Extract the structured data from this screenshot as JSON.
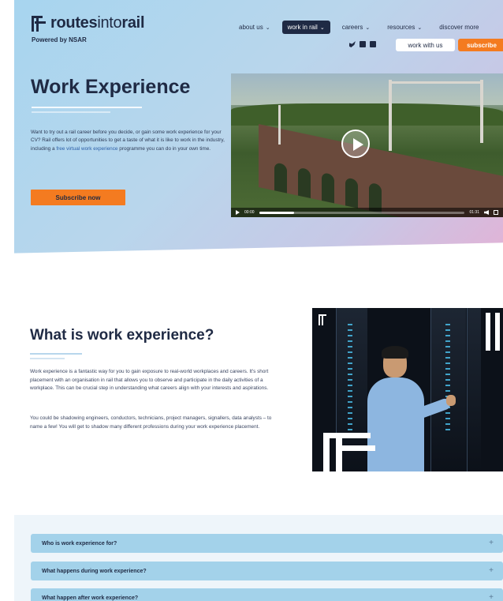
{
  "brand": {
    "name_bold_1": "routes",
    "name_thin": "into",
    "name_bold_2": "rail",
    "powered_by": "Powered by NSAR"
  },
  "nav": {
    "items": [
      {
        "label": "about us"
      },
      {
        "label": "work in rail"
      },
      {
        "label": "careers"
      },
      {
        "label": "resources"
      },
      {
        "label": "discover more"
      }
    ],
    "active_index": 1,
    "social_icons": [
      "twitter-icon",
      "instagram-icon",
      "linkedin-icon"
    ],
    "work_with_us": "work with us",
    "subscribe": "subscribe"
  },
  "hero": {
    "title": "Work Experience",
    "desc_before": "Want to try out a rail career before you decide, or gain some work experience for your CV? Rail offers lot of opportunities to get a taste of what it is like to work in the industry, including a ",
    "desc_link": "free virtual work experience",
    "desc_after": " programme you can do in your own time.",
    "subscribe_button": "Subscribe now"
  },
  "video": {
    "time_current": "00:00",
    "time_total": "01:31",
    "progress": 0.17
  },
  "section2": {
    "title": "What is work experience?",
    "p1": "Work experience is a fantastic way for you to gain exposure to real-world workplaces and careers. It's short placement with an organisation in rail that allows you to observe and participate in the daily activities of a workplace. This can be crucial step in understanding what careers align with your interests and aspirations.",
    "p2": "You could be shadowing engineers, conductors, technicians, project managers, signallers, data analysts – to name a few! You will get to shadow many different professions during your work experience placement."
  },
  "faq": [
    {
      "question": "Who is work experience for?"
    },
    {
      "question": "What happens during work experience?"
    },
    {
      "question": "What happen after work experience?"
    }
  ],
  "colors": {
    "navy": "#1f2a44",
    "orange": "#f47b20",
    "faq_blue": "#a3d2ea"
  }
}
